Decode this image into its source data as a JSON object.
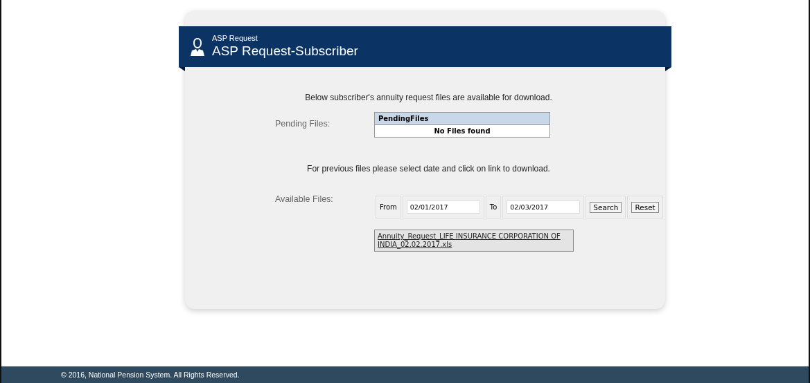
{
  "header": {
    "subtitle": "ASP Request",
    "title": "ASP Request-Subscriber"
  },
  "intro": "Below subscriber's annuity request files are available for download.",
  "pending": {
    "label": "Pending Files:",
    "column": "PendingFiles",
    "empty": "No Files found"
  },
  "previous_note": "For previous files please select date and click on link to download.",
  "available": {
    "label": "Available Files:",
    "from_label": "From",
    "from_value": "02/01/2017",
    "to_label": "To",
    "to_value": "02/03/2017",
    "buttons": [
      "Search",
      "Reset"
    ],
    "files": [
      "Annuity_Request_LIFE INSURANCE CORPORATION OF INDIA_02.02.2017.xls"
    ]
  },
  "footer": "© 2016, National Pension System. All Rights Reserved."
}
